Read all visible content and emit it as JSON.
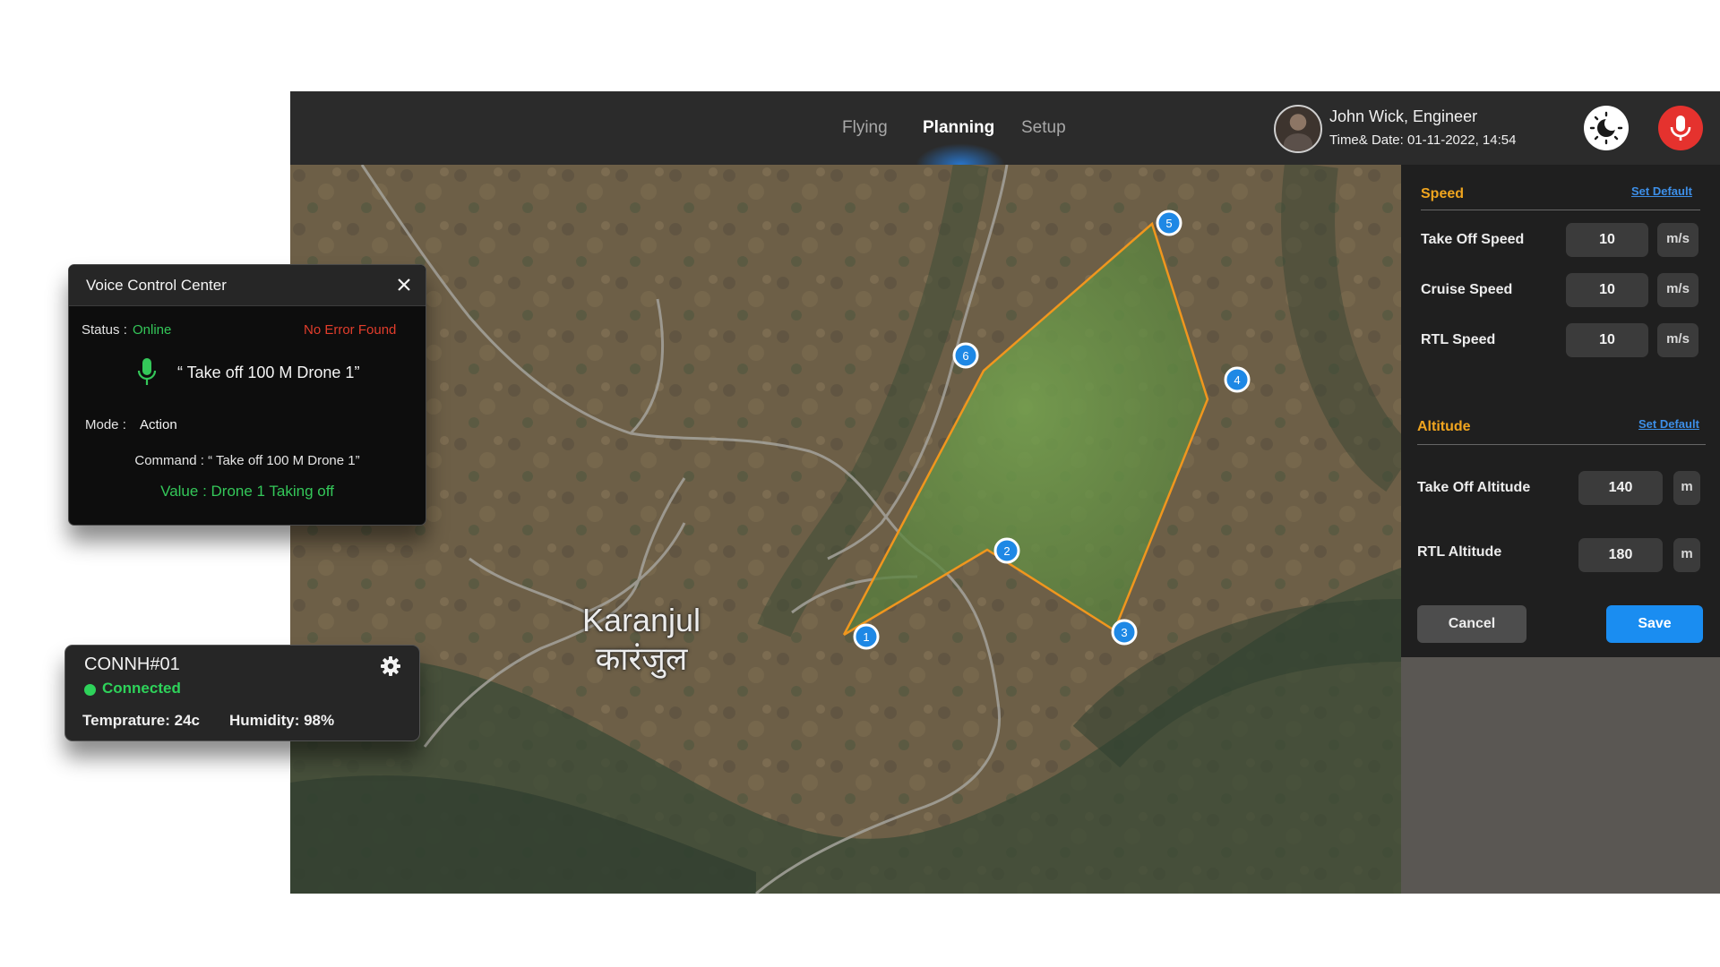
{
  "topbar": {
    "tabs": [
      {
        "label": "Flying",
        "active": false
      },
      {
        "label": "Planning",
        "active": true
      },
      {
        "label": "Setup",
        "active": false
      }
    ],
    "user_name": "John Wick, Engineer",
    "date_time": "Time& Date: 01-11-2022, 14:54",
    "theme_icon": "day-night-icon",
    "mic_icon": "microphone-icon",
    "mic_color": "#e5322e"
  },
  "map": {
    "place_name_en": "Karanjul",
    "place_name_local": "कारंजुल",
    "waypoints": [
      {
        "label": "1"
      },
      {
        "label": "2"
      },
      {
        "label": "3"
      },
      {
        "label": "4"
      },
      {
        "label": "5"
      },
      {
        "label": "6"
      }
    ],
    "route_color": "#f0961e",
    "waypoint_color": "#1e88e5"
  },
  "settings": {
    "speed": {
      "title": "Speed",
      "set_default": "Set Default",
      "fields": [
        {
          "label": "Take Off Speed",
          "value": "10",
          "unit": "m/s"
        },
        {
          "label": "Cruise Speed",
          "value": "10",
          "unit": "m/s"
        },
        {
          "label": "RTL Speed",
          "value": "10",
          "unit": "m/s"
        }
      ]
    },
    "altitude": {
      "title": "Altitude",
      "set_default": "Set Default",
      "fields": [
        {
          "label": "Take Off Altitude",
          "value": "140",
          "unit": "m"
        },
        {
          "label": "RTL Altitude",
          "value": "180",
          "unit": "m"
        }
      ]
    },
    "cancel_label": "Cancel",
    "save_label": "Save",
    "accent_color": "#f0a51f",
    "save_color": "#1a8df1"
  },
  "voice_control": {
    "title": "Voice Control Center",
    "status_label": "Status :",
    "status_value": "Online",
    "error_text": "No Error Found",
    "spoken_text": "“ Take off 100 M Drone 1”",
    "mode_label": "Mode :",
    "mode_value": "Action",
    "command_text": "Command : “ Take off 100 M Drone 1”",
    "value_text": "Value : Drone 1 Taking off"
  },
  "connection": {
    "id": "CONNH#01",
    "status": "Connected",
    "temperature": "Temprature: 24c",
    "humidity": "Humidity: 98%"
  }
}
